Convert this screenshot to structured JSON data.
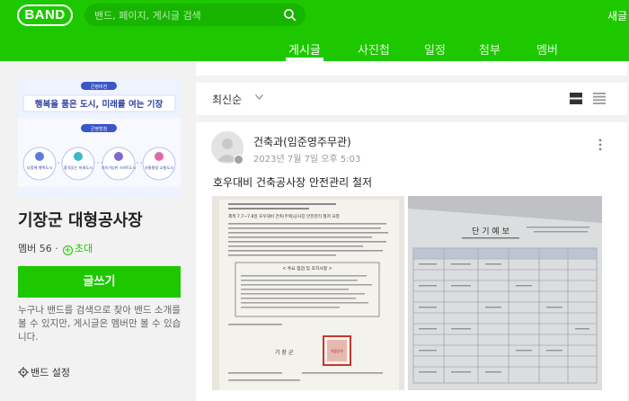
{
  "header": {
    "logo": "BAND",
    "search_placeholder": "밴드, 페이지, 게시글 검색",
    "new_label": "새글"
  },
  "tabs": [
    {
      "label": "게시글",
      "active": true
    },
    {
      "label": "사진첩",
      "active": false
    },
    {
      "label": "일정",
      "active": false
    },
    {
      "label": "첨부",
      "active": false
    },
    {
      "label": "멤버",
      "active": false
    }
  ],
  "sidebar": {
    "cover": {
      "slogan": "행복을 품은 도시, 미래를 여는 기장",
      "badge_top": "군정비전",
      "badge_mid": "군정방침",
      "circles": [
        "다함께 행복도시",
        "품격있는 미래도시",
        "지속가능한 스마트도시",
        "사통팔달 교통도시"
      ]
    },
    "band_name": "기장군 대형공사장",
    "members": "멤버 56 ·",
    "invite": "초대",
    "write_button": "글쓰기",
    "description": "누구나 밴드를 검색으로 찾아 밴드 소개를 볼 수 있지만, 게시글은 멤버만 볼 수 있습니다.",
    "settings": "밴드 설정"
  },
  "feed": {
    "sort_label": "최신순"
  },
  "post": {
    "author": "건축과(임준영주무관)",
    "date": "2023년 7월 7일 오후 5:03",
    "text": "호우대비 건축공사장 안전관리 철저",
    "doc1": {
      "heading": "제목 7.7~7.8일 호우대비 건축(주택)공사장 안전관리 철저 요청",
      "notice": "< 주요 점검 및 조치사항 >",
      "stamp": "기장군수",
      "footer": "기 장 군"
    },
    "doc2": {
      "heading": "단 기 예 보"
    }
  },
  "colors": {
    "brand": "#1ec800"
  }
}
